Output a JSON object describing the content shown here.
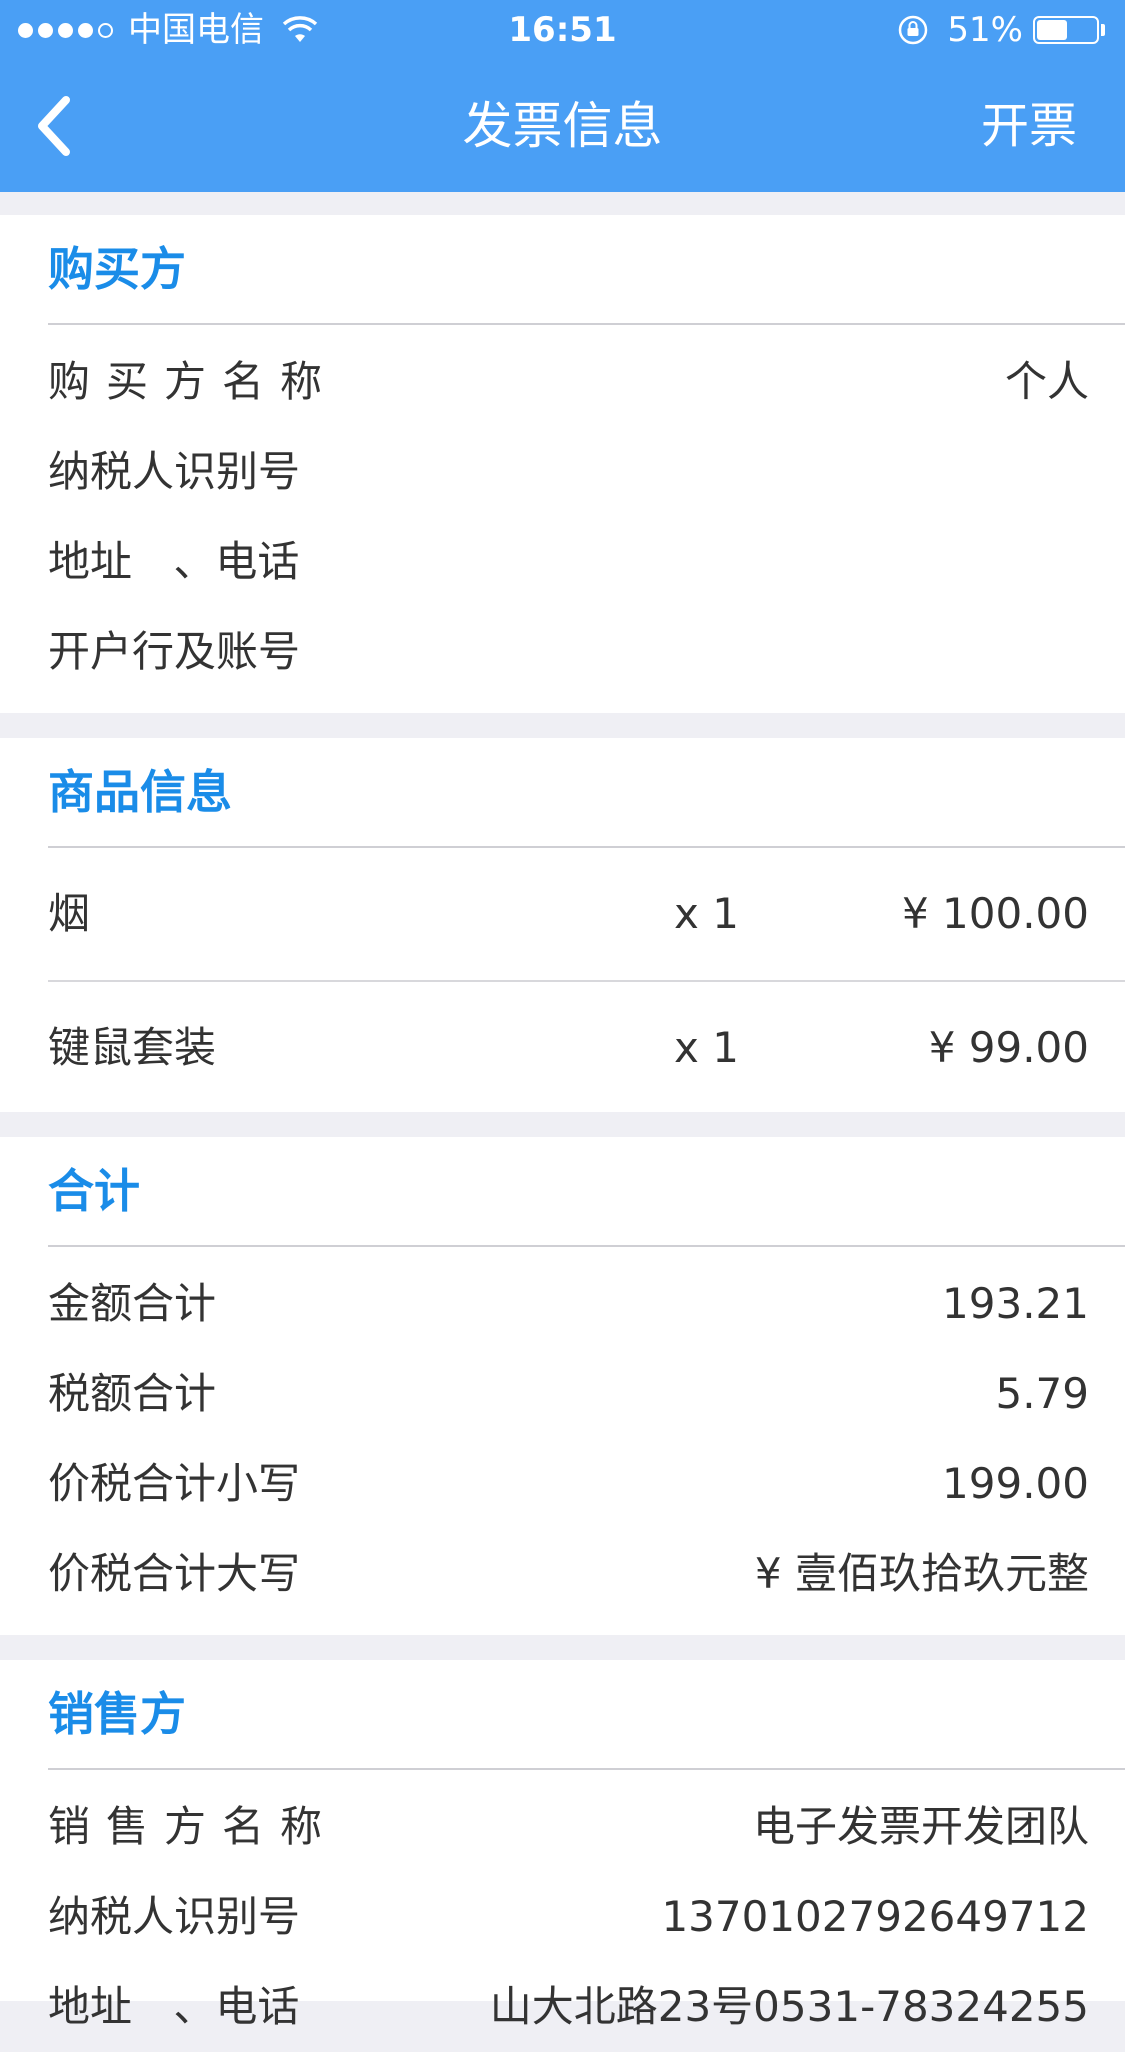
{
  "status_bar": {
    "carrier": "中国电信",
    "time": "16:51",
    "battery": "51%",
    "battery_level": 0.51
  },
  "nav": {
    "back_icon": "chevron-left-icon",
    "title": "发票信息",
    "action": "开票"
  },
  "buyer": {
    "title": "购买方",
    "rows": [
      {
        "label": "购买方名称",
        "value": "个人"
      },
      {
        "label": "纳税人识别号",
        "value": ""
      },
      {
        "label": "地址 、电话",
        "value": ""
      },
      {
        "label": "开户行及账号",
        "value": ""
      }
    ]
  },
  "goods": {
    "title": "商品信息",
    "items": [
      {
        "name": "烟",
        "qty": "x 1",
        "price": "¥ 100.00"
      },
      {
        "name": "键鼠套装",
        "qty": "x 1",
        "price": "¥ 99.00"
      }
    ]
  },
  "total": {
    "title": "合计",
    "rows": [
      {
        "label": "金额合计",
        "value": "193.21"
      },
      {
        "label": "税额合计",
        "value": "5.79"
      },
      {
        "label": "价税合计小写",
        "value": "199.00"
      },
      {
        "label": "价税合计大写",
        "value": "¥ 壹佰玖拾玖元整"
      }
    ]
  },
  "seller": {
    "title": "销售方",
    "rows": [
      {
        "label": "销售方名称",
        "value": "电子发票开发团队"
      },
      {
        "label": "纳税人识别号",
        "value": "1370102792649712"
      },
      {
        "label": "地址 、电话",
        "value": "山大北路23号0531-78324255"
      }
    ]
  },
  "colors": {
    "nav_background": "#4a9ff5",
    "section_title": "#1a8ce8",
    "page_background": "#efeff4"
  }
}
